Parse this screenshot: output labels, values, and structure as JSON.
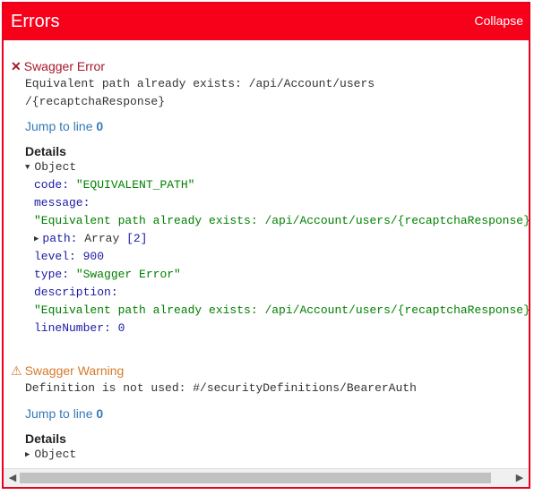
{
  "header": {
    "title": "Errors",
    "collapse_label": "Collapse"
  },
  "colors": {
    "accent": "#f7001a",
    "error": "#a6182b",
    "warning": "#d57a2a",
    "link": "#337ab7",
    "string": "#008000",
    "key": "#1a1aa6"
  },
  "errors": [
    {
      "icon": "close-icon",
      "icon_glyph": "✕",
      "title": "Swagger Error",
      "message_line1": "Equivalent path already exists: /api/Account/users",
      "message_line2": "/{recaptchaResponse}",
      "jump_text": "Jump to line",
      "jump_line": "0",
      "details_label": "Details",
      "object_label": "Object",
      "object_expanded": true,
      "fields": {
        "code_key": "code:",
        "code_value": "\"EQUIVALENT_PATH\"",
        "message_key": "message:",
        "message_value": "\"Equivalent path already exists: /api/Account/users/{recaptchaResponse}\"",
        "path_key": "path:",
        "path_type": "Array",
        "path_count": "[2]",
        "level_key": "level:",
        "level_value": "900",
        "type_key": "type:",
        "type_value": "\"Swagger Error\"",
        "description_key": "description:",
        "description_value": "\"Equivalent path already exists: /api/Account/users/{recaptchaResponse}\"",
        "linenumber_key": "lineNumber:",
        "linenumber_value": "0"
      }
    },
    {
      "icon": "warning-icon",
      "icon_glyph": "⚠",
      "title": "Swagger Warning",
      "message_line1": "Definition is not used: #/securityDefinitions/BearerAuth",
      "jump_text": "Jump to line",
      "jump_line": "0",
      "details_label": "Details",
      "object_label": "Object",
      "object_expanded": false
    }
  ],
  "scrollbar": {
    "left_icon": "chevron-left-icon",
    "right_icon": "chevron-right-icon"
  }
}
